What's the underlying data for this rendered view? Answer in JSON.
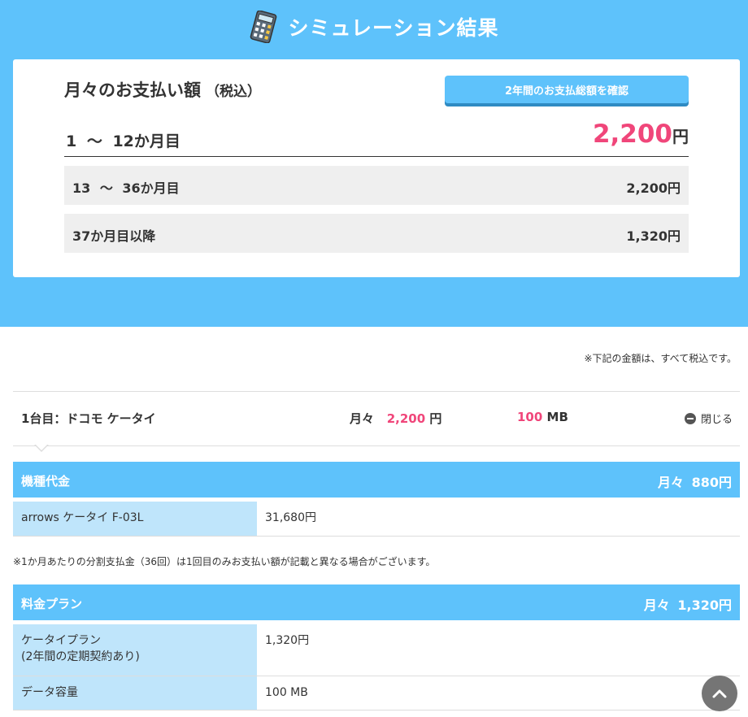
{
  "header": {
    "title": "シミュレーション結果",
    "icon": "calculator-icon"
  },
  "summary": {
    "heading": "月々のお支払い額",
    "heading_tax": "（税込）",
    "total_button_label": "2年間のお支払総額を確認",
    "main_row": {
      "period": "1 ～ 12か月目",
      "price": "2,200",
      "unit": "円"
    },
    "rows": [
      {
        "period": "13 ～ 36か月目",
        "amount": "2,200円"
      },
      {
        "period": "37か月目以降",
        "amount": "1,320円"
      }
    ]
  },
  "tax_note": "※下記の金額は、すべて税込です。",
  "line": {
    "name": "1台目：ドコモ ケータイ",
    "monthly_label": "月々",
    "monthly_price": "2,200",
    "monthly_unit": "円",
    "data_amount": "100",
    "data_unit": "MB",
    "close_label": "閉じる"
  },
  "device_section": {
    "label": "機種代金",
    "monthly": "月々 880円",
    "rows": [
      {
        "key": "arrows ケータイ F-03L",
        "value": "31,680円"
      }
    ],
    "note": "※1か月あたりの分割支払金（36回）は1回目のみお支払い額が記載と異なる場合がございます。"
  },
  "plan_section": {
    "label": "料金プラン",
    "monthly": "月々 1,320円",
    "rows": [
      {
        "key_line1": "ケータイプラン",
        "key_line2": "(2年間の定期契約あり)",
        "value": "1,320円"
      },
      {
        "key": "データ容量",
        "value": "100 MB"
      }
    ]
  },
  "colors": {
    "accent": "#5ec2fb",
    "price_pink": "#f0467a",
    "key_cell": "#bfe5fb"
  }
}
